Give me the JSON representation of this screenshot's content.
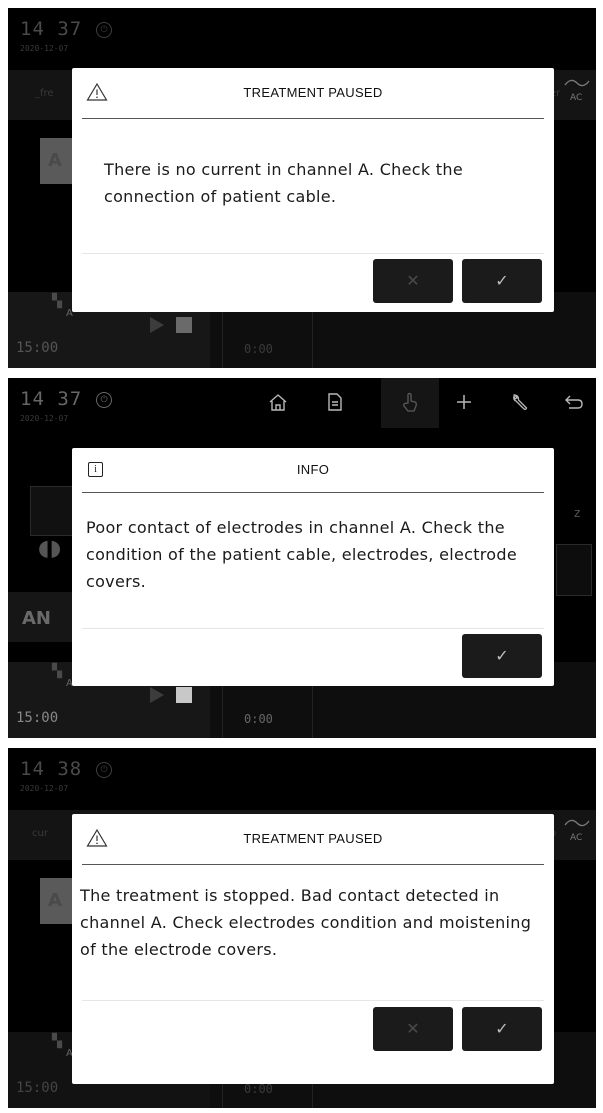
{
  "panels": [
    {
      "clock": {
        "time": "14 37",
        "date": "2020-12-07"
      },
      "background": {
        "channel_label": "_fre",
        "channel_letter": "A",
        "right_label": "er",
        "ac_label": "AC",
        "timer": "15:00",
        "elapsed": "0:00",
        "channel_marker": "A"
      },
      "dialog": {
        "icon": "warning-icon",
        "title": "TREATMENT PAUSED",
        "message": "There is no current in channel A. Check the connection of patient cable.",
        "cancel_label": "✕",
        "confirm_label": "✓"
      }
    },
    {
      "clock": {
        "time": "14 37",
        "date": "2020-12-07"
      },
      "toolbar": [
        "home-icon",
        "document-icon",
        "hand-pointer-icon",
        "plus-icon",
        "wrench-icon",
        "back-arrow-icon"
      ],
      "background": {
        "program_label": "AN",
        "right_label": "z",
        "timer": "15:00",
        "elapsed": "0:00",
        "channel_marker": "A"
      },
      "dialog": {
        "icon": "info-icon",
        "icon_glyph": "i",
        "title": "INFO",
        "message": "Poor contact of electrodes in channel A. Check the condition of the patient cable, electrodes, electrode covers.",
        "confirm_label": "✓"
      }
    },
    {
      "clock": {
        "time": "14 38",
        "date": "2020-12-07"
      },
      "background": {
        "channel_label": "cur",
        "channel_letter": "A",
        "right_label": "o",
        "ac_label": "AC",
        "timer": "15:00",
        "elapsed": "0:00",
        "channel_marker": "A"
      },
      "dialog": {
        "icon": "warning-icon",
        "title": "TREATMENT PAUSED",
        "message": "The treatment is stopped. Bad contact detected in channel A. Check electrodes condition and moistening of the electrode covers.",
        "cancel_label": "✕",
        "confirm_label": "✓"
      }
    }
  ]
}
